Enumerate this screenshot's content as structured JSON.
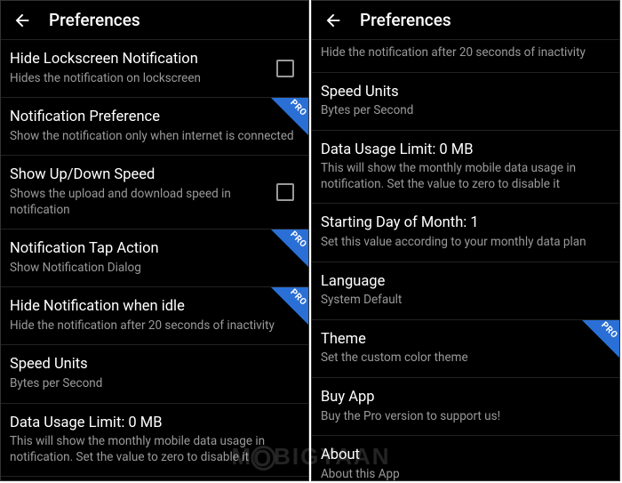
{
  "pro_label": "PRO",
  "watermark": "MOBIGYAAN",
  "left": {
    "header": {
      "title": "Preferences"
    },
    "items": [
      {
        "title": "Hide Lockscreen Notification",
        "sub": "Hides the notification on lockscreen",
        "checkbox": true,
        "pro": false
      },
      {
        "title": "Notification Preference",
        "sub": "Show the notification only when internet is connected",
        "checkbox": false,
        "pro": true
      },
      {
        "title": "Show Up/Down Speed",
        "sub": "Shows the upload and download speed in notification",
        "checkbox": true,
        "pro": false
      },
      {
        "title": "Notification Tap Action",
        "sub": "Show Notification Dialog",
        "checkbox": false,
        "pro": true
      },
      {
        "title": "Hide Notification when idle",
        "sub": "Hide the notification after 20 seconds of inactivity",
        "checkbox": false,
        "pro": true
      },
      {
        "title": "Speed Units",
        "sub": "Bytes per Second",
        "checkbox": false,
        "pro": false
      },
      {
        "title": "Data Usage Limit: 0 MB",
        "sub": "This will show the monthly mobile data usage in notification. Set the value to zero to disable it",
        "checkbox": false,
        "pro": false
      }
    ]
  },
  "right": {
    "header": {
      "title": "Preferences"
    },
    "top_fragment_sub": "Hide the notification after 20 seconds of inactivity",
    "items": [
      {
        "title": "Speed Units",
        "sub": "Bytes per Second",
        "pro": false
      },
      {
        "title": "Data Usage Limit: 0 MB",
        "sub": "This will show the monthly mobile data usage in notification. Set the value to zero to disable it",
        "pro": false
      },
      {
        "title": "Starting Day of Month: 1",
        "sub": "Set this value according to your monthly data plan",
        "pro": false
      },
      {
        "title": "Language",
        "sub": "System Default",
        "pro": false
      },
      {
        "title": "Theme",
        "sub": "Set the custom color theme",
        "pro": true
      },
      {
        "title": "Buy App",
        "sub": "Buy the Pro version to support us!",
        "pro": false
      },
      {
        "title": "About",
        "sub": "About this App",
        "pro": false
      }
    ]
  }
}
